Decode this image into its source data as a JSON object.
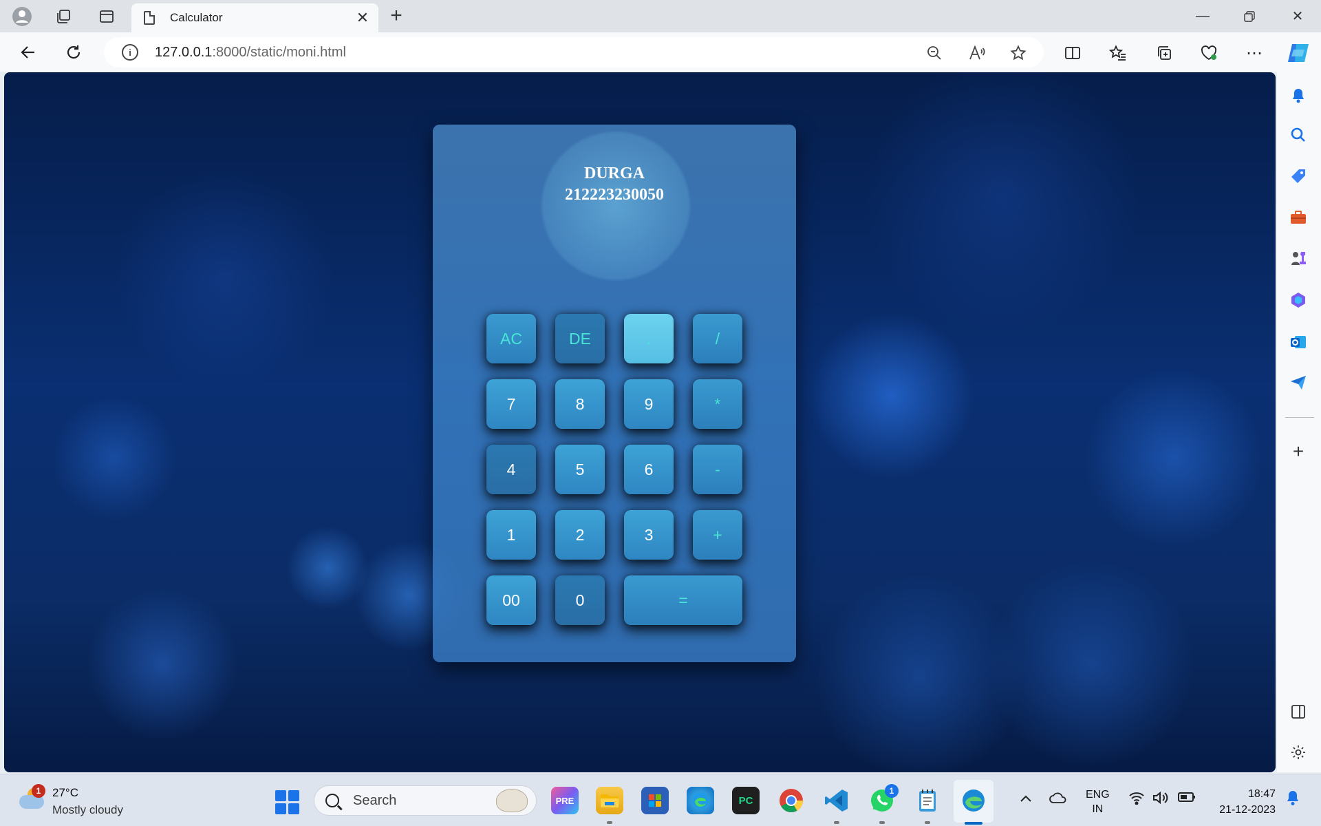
{
  "browser": {
    "tab_title": "Calculator",
    "url_host": "127.0.0.1",
    "url_rest": ":8000/static/moni.html"
  },
  "page": {
    "heading_name": "DURGA",
    "heading_id": "212223230050"
  },
  "calculator": {
    "keys": [
      {
        "label": "AC",
        "style": "op"
      },
      {
        "label": "DE",
        "style": "op dark"
      },
      {
        "label": ".",
        "style": "op light"
      },
      {
        "label": "/",
        "style": "op"
      },
      {
        "label": "7",
        "style": ""
      },
      {
        "label": "8",
        "style": ""
      },
      {
        "label": "9",
        "style": ""
      },
      {
        "label": "*",
        "style": "op"
      },
      {
        "label": "4",
        "style": "dark"
      },
      {
        "label": "5",
        "style": ""
      },
      {
        "label": "6",
        "style": ""
      },
      {
        "label": "-",
        "style": "op"
      },
      {
        "label": "1",
        "style": ""
      },
      {
        "label": "2",
        "style": ""
      },
      {
        "label": "3",
        "style": ""
      },
      {
        "label": "+",
        "style": "op"
      },
      {
        "label": "00",
        "style": ""
      },
      {
        "label": "0",
        "style": "dark"
      },
      {
        "label": "=",
        "style": "op"
      }
    ]
  },
  "taskbar": {
    "weather_temp": "27°C",
    "weather_condition": "Mostly cloudy",
    "weather_badge": "1",
    "search_placeholder": "Search",
    "whatsapp_badge": "1",
    "lang_line1": "ENG",
    "lang_line2": "IN",
    "time": "18:47",
    "date": "21-12-2023"
  },
  "colors": {
    "accent": "#0067c0",
    "key_text_operator": "#48e6d6",
    "key_text_digit": "#ffffff"
  }
}
